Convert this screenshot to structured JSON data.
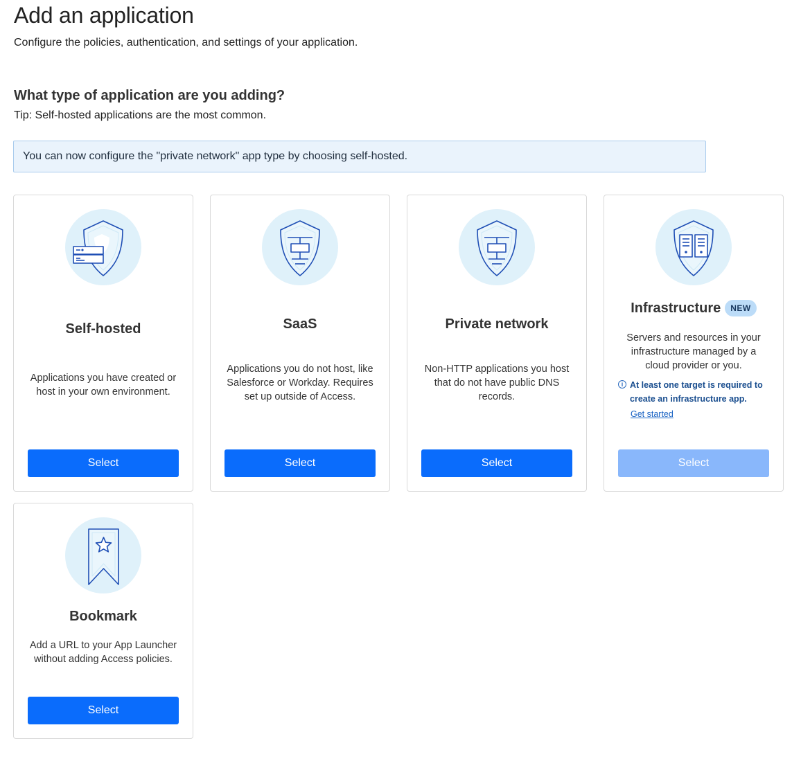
{
  "header": {
    "title": "Add an application",
    "subtitle": "Configure the policies, authentication, and settings of your application."
  },
  "question": {
    "title": "What type of application are you adding?",
    "tip": "Tip: Self-hosted applications are the most common."
  },
  "banner": {
    "text": "You can now configure the \"private network\" app type by choosing self-hosted."
  },
  "cards": {
    "self_hosted": {
      "icon": "shield-server-icon",
      "title": "Self-hosted",
      "description": "Applications you have created or host in your own environment.",
      "button": "Select"
    },
    "saas": {
      "icon": "shield-network-icon",
      "title": "SaaS",
      "description": "Applications you do not host, like Salesforce or Workday. Requires set up outside of Access.",
      "button": "Select"
    },
    "private_network": {
      "icon": "shield-network-icon",
      "title": "Private network",
      "description": "Non-HTTP applications you host that do not have public DNS records.",
      "button": "Select"
    },
    "infrastructure": {
      "icon": "shield-servers-icon",
      "title": "Infrastructure",
      "badge": "NEW",
      "description": "Servers and resources in your infrastructure managed by a cloud provider or you.",
      "notice": "At least one target is required to create an infrastructure app.",
      "notice_icon": "info-icon",
      "link": "Get started",
      "button": "Select",
      "button_disabled": true
    },
    "bookmark": {
      "icon": "bookmark-star-icon",
      "title": "Bookmark",
      "description": "Add a URL to your App Launcher without adding Access policies.",
      "button": "Select"
    }
  },
  "colors": {
    "primary": "#0a6cfc",
    "primary_disabled": "#89b7fb",
    "icon_bg": "#dff1fa",
    "icon_stroke": "#1f4fb5",
    "banner_bg": "#eaf3fc",
    "banner_border": "#a9cbed"
  }
}
